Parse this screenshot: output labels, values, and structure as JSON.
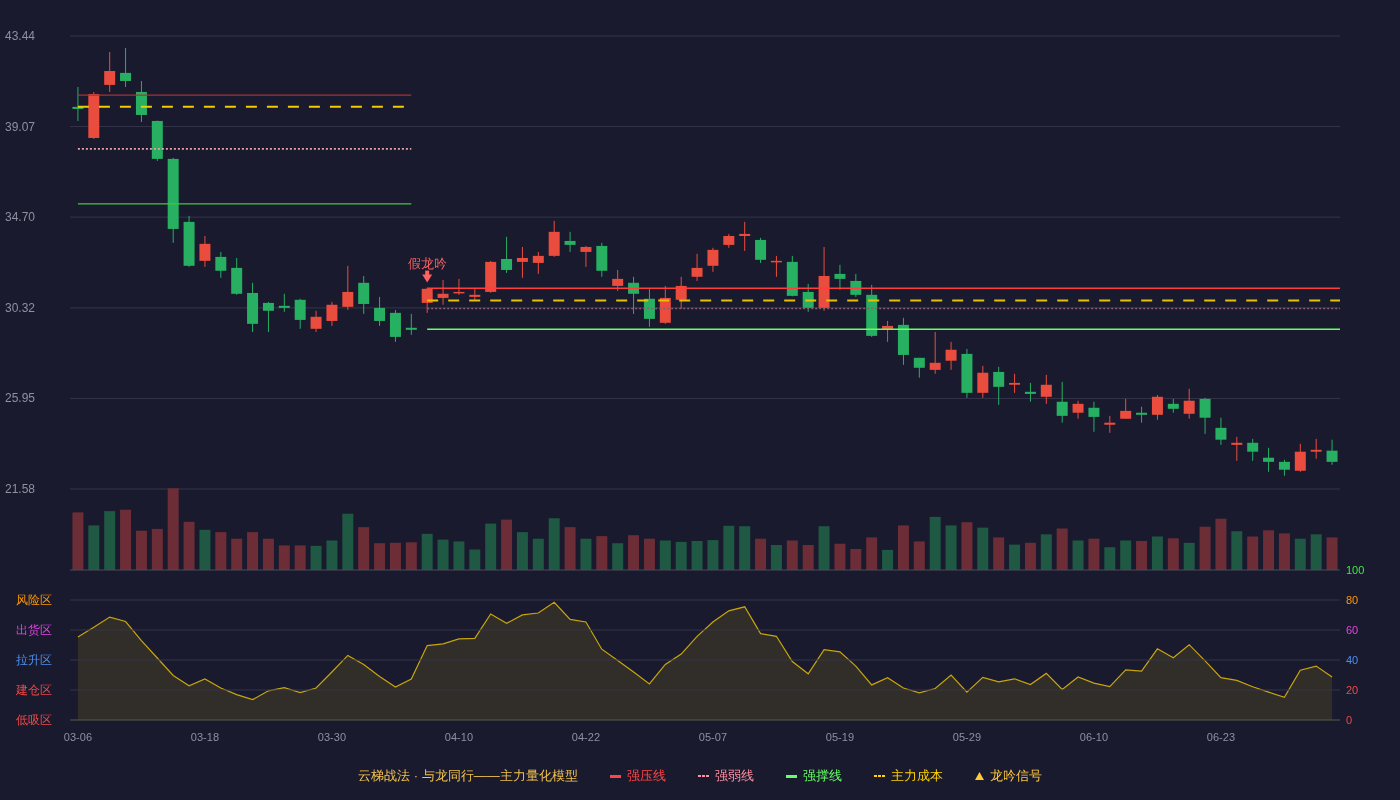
{
  "price_chart": {
    "chart_data": {
      "type": "candlestick",
      "categories": [
        null,
        null,
        null,
        null,
        null,
        null,
        null,
        null,
        null,
        null,
        null,
        null,
        null,
        null,
        null,
        null,
        null,
        null,
        null,
        null,
        null,
        null,
        null,
        null,
        null,
        null,
        null,
        null,
        null,
        null,
        null,
        null,
        null,
        null,
        null,
        null,
        null,
        null,
        null,
        null,
        null,
        null,
        null,
        null,
        null,
        null,
        null,
        null,
        null,
        null,
        null,
        null,
        null,
        null,
        null,
        null,
        null,
        null,
        null,
        null,
        null,
        null,
        null,
        null,
        null,
        null,
        null,
        null,
        null,
        null,
        null,
        null,
        null,
        null,
        null,
        null,
        null,
        null,
        null,
        null
      ],
      "ohlc": [
        [
          40.02,
          40.98,
          39.34,
          39.92
        ],
        [
          38.52,
          40.74,
          38.47,
          40.64
        ],
        [
          41.08,
          42.67,
          40.74,
          41.75
        ],
        [
          41.66,
          42.86,
          40.98,
          41.27
        ],
        [
          40.74,
          41.27,
          39.29,
          39.63
        ],
        [
          39.34,
          39.36,
          37.41,
          37.51
        ],
        [
          37.51,
          37.56,
          33.46,
          34.13
        ],
        [
          34.47,
          34.76,
          32.3,
          32.35
        ],
        [
          32.59,
          33.79,
          32.3,
          33.41
        ],
        [
          32.78,
          33.02,
          31.77,
          32.11
        ],
        [
          32.25,
          32.73,
          30.95,
          31.0
        ],
        [
          31.04,
          31.53,
          29.16,
          29.55
        ],
        [
          30.56,
          30.61,
          29.16,
          30.18
        ],
        [
          30.42,
          31.0,
          30.13,
          30.32
        ],
        [
          30.71,
          30.76,
          29.31,
          29.74
        ],
        [
          29.31,
          30.18,
          29.16,
          29.89
        ],
        [
          29.69,
          30.61,
          29.45,
          30.47
        ],
        [
          30.37,
          32.35,
          30.22,
          31.09
        ],
        [
          31.53,
          31.86,
          30.03,
          30.51
        ],
        [
          30.32,
          30.85,
          29.45,
          29.69
        ],
        [
          30.08,
          30.22,
          28.68,
          28.92
        ],
        [
          29.36,
          30.03,
          29.02,
          29.26
        ],
        [
          30.56,
          31.3,
          30.08,
          31.24
        ],
        [
          30.8,
          31.67,
          30.47,
          31.0
        ],
        [
          31.04,
          31.72,
          30.95,
          31.09
        ],
        [
          30.85,
          31.29,
          30.71,
          30.95
        ],
        [
          31.09,
          32.59,
          31.05,
          32.54
        ],
        [
          32.68,
          33.75,
          32.01,
          32.15
        ],
        [
          32.54,
          33.26,
          31.77,
          32.73
        ],
        [
          32.49,
          33.02,
          31.96,
          32.83
        ],
        [
          32.83,
          34.52,
          32.78,
          33.99
        ],
        [
          33.55,
          33.99,
          33.02,
          33.36
        ],
        [
          33.02,
          33.31,
          32.3,
          33.26
        ],
        [
          33.31,
          33.46,
          31.82,
          32.11
        ],
        [
          31.38,
          32.15,
          31.14,
          31.72
        ],
        [
          31.53,
          31.82,
          30.03,
          31.0
        ],
        [
          30.76,
          31.24,
          29.41,
          29.79
        ],
        [
          29.6,
          31.38,
          29.55,
          30.8
        ],
        [
          30.71,
          31.82,
          30.27,
          31.38
        ],
        [
          31.82,
          32.93,
          31.62,
          32.25
        ],
        [
          32.35,
          33.22,
          32.06,
          33.12
        ],
        [
          33.36,
          33.89,
          33.22,
          33.79
        ],
        [
          33.79,
          34.47,
          33.07,
          33.89
        ],
        [
          33.6,
          33.7,
          32.49,
          32.64
        ],
        [
          32.54,
          32.83,
          31.82,
          32.59
        ],
        [
          32.54,
          32.83,
          30.88,
          30.9
        ],
        [
          31.09,
          31.48,
          30.13,
          30.32
        ],
        [
          30.32,
          33.26,
          30.18,
          31.86
        ],
        [
          31.96,
          32.4,
          31.19,
          31.72
        ],
        [
          31.62,
          31.96,
          30.85,
          30.95
        ],
        [
          30.95,
          31.43,
          28.92,
          28.97
        ],
        [
          29.26,
          29.69,
          28.68,
          29.45
        ],
        [
          29.5,
          29.84,
          27.57,
          28.05
        ],
        [
          27.91,
          27.91,
          26.95,
          27.43
        ],
        [
          27.33,
          29.16,
          27.14,
          27.67
        ],
        [
          27.77,
          28.68,
          27.33,
          28.3
        ],
        [
          28.1,
          28.34,
          25.98,
          26.22
        ],
        [
          26.22,
          27.52,
          25.98,
          27.19
        ],
        [
          27.23,
          27.48,
          25.64,
          26.51
        ],
        [
          26.61,
          27.14,
          26.22,
          26.7
        ],
        [
          26.27,
          26.7,
          25.79,
          26.17
        ],
        [
          26.03,
          27.09,
          25.69,
          26.61
        ],
        [
          25.79,
          26.75,
          24.78,
          25.11
        ],
        [
          25.26,
          25.84,
          24.97,
          25.69
        ],
        [
          25.5,
          25.79,
          24.34,
          25.06
        ],
        [
          24.68,
          25.11,
          24.29,
          24.78
        ],
        [
          24.97,
          25.93,
          24.97,
          25.35
        ],
        [
          25.26,
          25.55,
          24.78,
          25.16
        ],
        [
          25.16,
          26.12,
          24.92,
          26.03
        ],
        [
          25.69,
          25.93,
          25.26,
          25.45
        ],
        [
          25.21,
          26.42,
          24.97,
          25.84
        ],
        [
          25.93,
          25.98,
          24.24,
          25.02
        ],
        [
          24.53,
          25.02,
          23.71,
          23.96
        ],
        [
          23.71,
          24.1,
          22.94,
          23.81
        ],
        [
          23.81,
          24.0,
          22.94,
          23.38
        ],
        [
          23.09,
          23.57,
          22.41,
          22.89
        ],
        [
          22.89,
          22.99,
          22.22,
          22.51
        ],
        [
          22.46,
          23.76,
          22.41,
          23.38
        ],
        [
          23.38,
          24.0,
          23.04,
          23.47
        ],
        [
          23.43,
          23.96,
          22.75,
          22.89
        ]
      ],
      "ylim": [
        21.58,
        43.44
      ],
      "yticks": [
        {
          "value": 43.44,
          "label": "43.44"
        },
        {
          "value": 39.07,
          "label": "39.07"
        },
        {
          "value": 34.7,
          "label": "34.70"
        },
        {
          "value": 30.32,
          "label": "30.32"
        },
        {
          "value": 25.95,
          "label": "25.95"
        },
        {
          "value": 21.58,
          "label": "21.58"
        }
      ],
      "grid": true,
      "ref_lines": [
        {
          "axis": "y",
          "value": 40.59,
          "color": "#a3323b"
        },
        {
          "axis": "y",
          "value": 37.99,
          "color": "#e8a3a6"
        },
        {
          "axis": "y",
          "value": 35.34,
          "color": "#43c443"
        },
        {
          "axis": "y",
          "value": 40.03,
          "color": "#f2cc00"
        },
        {
          "axis": "y",
          "value": 31.27,
          "color": "#ff3d3d"
        },
        {
          "axis": "y",
          "value": 30.29,
          "color": "#8e5b6c"
        },
        {
          "axis": "y",
          "value": 29.29,
          "color": "#66ff66"
        },
        {
          "axis": "y",
          "value": 30.67,
          "color": "#e5c100"
        }
      ],
      "annotations": [
        {
          "text": "假龙吟",
          "y": 31.3
        }
      ]
    }
  },
  "indicator_chart": {
    "chart_data": {
      "type": "area",
      "categories": [
        "03-06",
        null,
        null,
        null,
        null,
        null,
        null,
        null,
        "03-18",
        null,
        null,
        null,
        null,
        null,
        null,
        null,
        "03-30",
        null,
        null,
        null,
        null,
        null,
        null,
        null,
        "04-10",
        null,
        null,
        null,
        null,
        null,
        null,
        null,
        "04-22",
        null,
        null,
        null,
        null,
        null,
        null,
        null,
        "05-07",
        null,
        null,
        null,
        null,
        null,
        null,
        null,
        "05-19",
        null,
        null,
        null,
        null,
        null,
        null,
        null,
        "05-29",
        null,
        null,
        null,
        null,
        null,
        null,
        null,
        "06-10",
        null,
        null,
        null,
        null,
        null,
        null,
        null,
        "06-23",
        null,
        null,
        null,
        null,
        null,
        null,
        null
      ],
      "ylim": [
        0,
        100
      ],
      "yticks": [
        0,
        20,
        40,
        60,
        80,
        100
      ],
      "grid": true,
      "series": [
        {
          "color": "#c9a50c",
          "values": [
            55.3,
            61.8,
            68.6,
            65.7,
            52.9,
            41.3,
            29.7,
            22.8,
            27.3,
            21.3,
            16.9,
            13.6,
            19.5,
            21.6,
            18.3,
            21.3,
            32.0,
            43.1,
            37.1,
            29.1,
            21.9,
            27.3,
            49.6,
            50.8,
            54.1,
            54.4,
            70.7,
            64.5,
            70.1,
            71.3,
            78.5,
            67.1,
            65.3,
            47.2,
            39.7,
            32.0,
            24.0,
            37.1,
            43.9,
            55.8,
            65.3,
            72.8,
            75.5,
            57.6,
            55.8,
            38.9,
            30.8,
            46.9,
            45.4,
            35.9,
            23.4,
            28.2,
            21.3,
            18.1,
            21.0,
            29.9,
            18.6,
            28.4,
            25.5,
            27.5,
            23.7,
            31.1,
            20.4,
            28.7,
            24.6,
            22.2,
            33.5,
            32.6,
            47.5,
            41.5,
            50.2,
            39.5,
            28.2,
            26.4,
            22.2,
            18.6,
            15.1,
            33.2,
            35.9,
            28.7
          ]
        }
      ],
      "annotations": [
        "风险区",
        "出货区",
        "拉升区",
        "建仓区",
        "低吸区"
      ]
    }
  },
  "legend": {
    "title": "云梯战法 · 与龙同行——主力量化模型",
    "items": [
      {
        "label": "强压线",
        "kind": "solid",
        "color": "#ff4545"
      },
      {
        "label": "强弱线",
        "kind": "dotted",
        "color": "#ff8f9f"
      },
      {
        "label": "强撑线",
        "kind": "solid",
        "color": "#66ff66"
      },
      {
        "label": "主力成本",
        "kind": "dashed",
        "color": "#ffd400"
      },
      {
        "label": "龙吟信号",
        "kind": "triangle",
        "color": "#ffc83d"
      }
    ]
  }
}
